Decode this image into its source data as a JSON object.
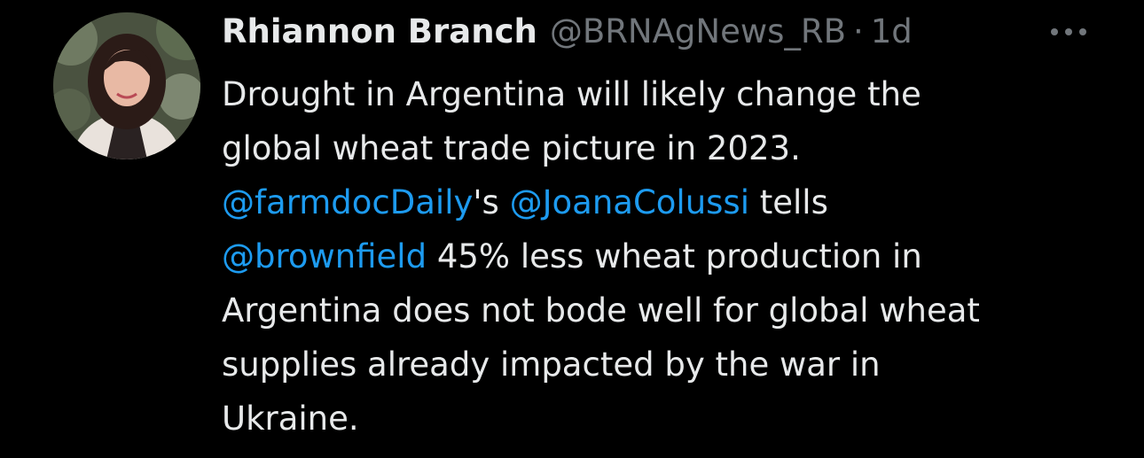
{
  "tweet": {
    "author": {
      "display_name": "Rhiannon Branch",
      "handle": "@BRNAgNews_RB",
      "avatar_icon": "profile-photo"
    },
    "separator": "·",
    "time": "1d",
    "more_icon": "more-horizontal-icon",
    "text": {
      "line1": "Drought in Argentina will likely change the",
      "line2": "global wheat trade picture in 2023.",
      "mention1": "@farmdocDaily",
      "mention1_suffix": "'s ",
      "mention2": "@JoanaColussi",
      "mention2_suffix": " tells",
      "mention3": "@brownfield",
      "line4_rest": " 45% less wheat production in",
      "line5": "Argentina does not bode well for global wheat",
      "line6": "supplies already impacted by the war in",
      "line7": "Ukraine."
    }
  },
  "colors": {
    "background": "#000000",
    "text": "#e7e9ea",
    "secondary": "#71767b",
    "link": "#1d9bf0"
  }
}
